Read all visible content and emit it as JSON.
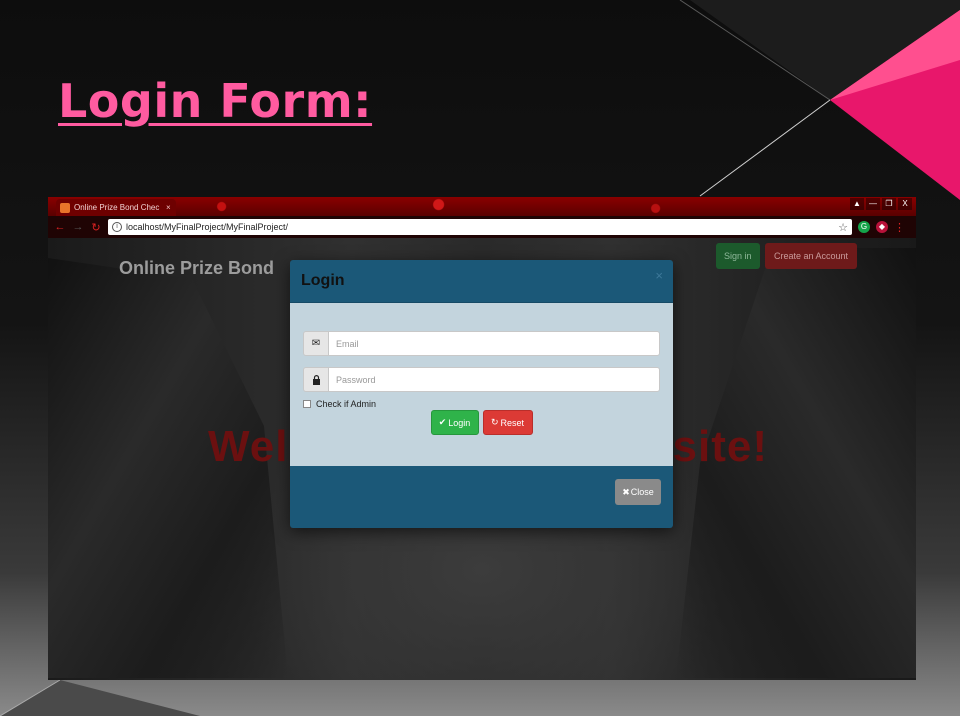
{
  "slide": {
    "title": "Login Form:"
  },
  "colors": {
    "slide_title": "#ff5ba0",
    "modal_header": "#1b5878",
    "login_button": "#2fb34a",
    "reset_button": "#dc3a35",
    "close_button": "#8a8a8a"
  },
  "browser": {
    "tab_title": "Online Prize Bond Chec",
    "tab_close": "×",
    "window_buttons": [
      "▲",
      "—",
      "❐",
      "X"
    ],
    "url": "localhost/MyFinalProject/MyFinalProject/",
    "icons": {
      "back": "back-arrow-icon",
      "forward": "forward-arrow-icon",
      "reload": "reload-icon",
      "info": "info-icon",
      "star": "bookmark-star-icon",
      "grammarly": "grammarly-icon",
      "shield": "shield-extension-icon",
      "menu": "menu-dots-icon"
    }
  },
  "site": {
    "brand": "Online Prize Bond",
    "welcome_left": "Wel",
    "welcome_right": "site!",
    "sign_in": "Sign in",
    "create_account": "Create an Account"
  },
  "modal": {
    "title": "Login",
    "close_x": "×",
    "email_placeholder": "Email",
    "password_placeholder": "Password",
    "admin_check_label": "Check if Admin",
    "login_label": "Login",
    "reset_label": "Reset",
    "close_label": "Close",
    "icons": {
      "email": "envelope-icon",
      "password": "lock-icon",
      "login": "checkmark-icon",
      "reset": "refresh-icon",
      "close": "close-x-icon"
    }
  }
}
